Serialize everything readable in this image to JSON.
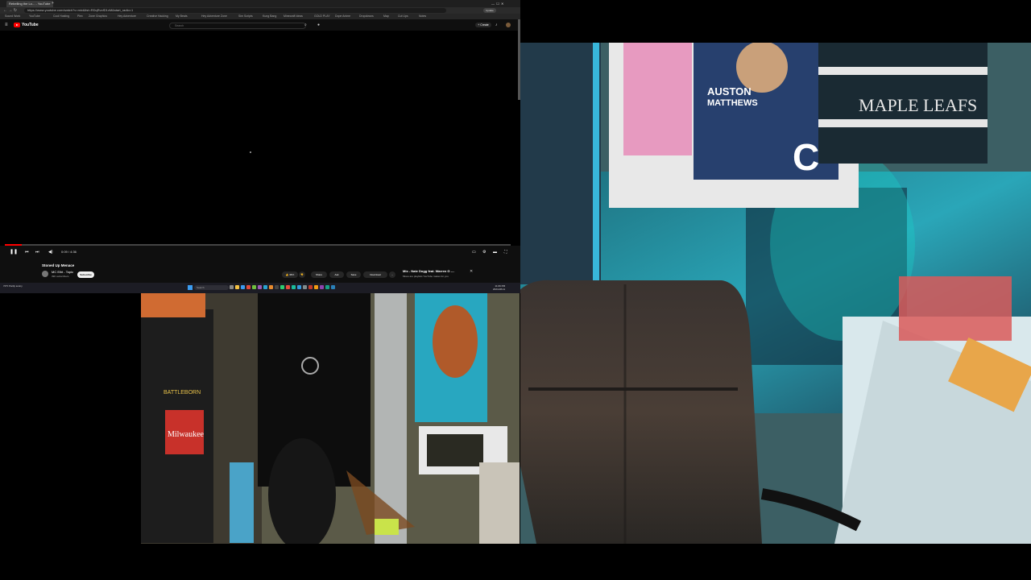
{
  "browser": {
    "tabs": [
      "Rebelling the Lo... - YouTube",
      "",
      "",
      "",
      "",
      "",
      "",
      "",
      "",
      "",
      "",
      "",
      ""
    ],
    "url": "https://www.youtube.com/watch?v=mix&list=RDqRvcfD1vM&start_radio=1",
    "bookmarks": [
      "Sound Work",
      "YouTube",
      "Cool Hosting",
      "Plex",
      "Zone Graphics",
      "Hey Adventure",
      "Creative Hacking",
      "My Beats",
      "Hey Adventure Zone",
      "Sim Scripts",
      "Kung Bang",
      "Minecraft Ideas",
      "GOLD PLAY",
      "Dope Anime",
      "Dropdowns",
      "Map",
      "Cut Ups",
      "Notes"
    ]
  },
  "youtube": {
    "brand": "YouTube",
    "search_placeholder": "Search",
    "create_label": "+ Create",
    "time": "0:09 / 4:36",
    "progress_fraction": 0.033,
    "video_title": "Stoned Up Menace",
    "channel": "MC Eiht - Topic",
    "subscribers": "39K subscribers",
    "subscribe_label": "Subscribe",
    "like_count": "38 K",
    "actions": [
      "Share",
      "Ask",
      "Save",
      "Download",
      "..."
    ],
    "mix_title": "Mix - Nate Dogg feat. Warren G -...",
    "mix_subtitle": "Mixes are playlists YouTube makes for you"
  },
  "taskbar": {
    "weather": "72°F Partly sunny",
    "search_placeholder": "Search",
    "clock_time": "11:06 PM",
    "clock_date": "2024-08-11"
  },
  "camera": {
    "room_labels": [
      "AUSTON",
      "MATTHEWS",
      "MAPLE LEAFS"
    ],
    "desk_labels": [
      "Milwaukee",
      "BATTLEBORN"
    ]
  },
  "colors": {
    "yt_red": "#ff0000",
    "bg": "#000000",
    "browser_bg": "#0f0f0f"
  }
}
